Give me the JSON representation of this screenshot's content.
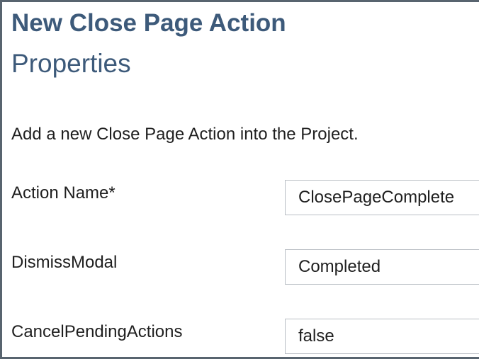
{
  "header": {
    "title": "New Close Page Action",
    "section": "Properties"
  },
  "description": "Add a new Close Page Action into the Project.",
  "fields": [
    {
      "label": "Action Name*",
      "value": "ClosePageComplete"
    },
    {
      "label": "DismissModal",
      "value": "Completed"
    },
    {
      "label": "CancelPendingActions",
      "value": "false"
    }
  ],
  "colors": {
    "heading": "#3d5a7a",
    "text": "#1f1f1f",
    "frame_border": "#58646f",
    "input_border": "#b9bec4"
  }
}
